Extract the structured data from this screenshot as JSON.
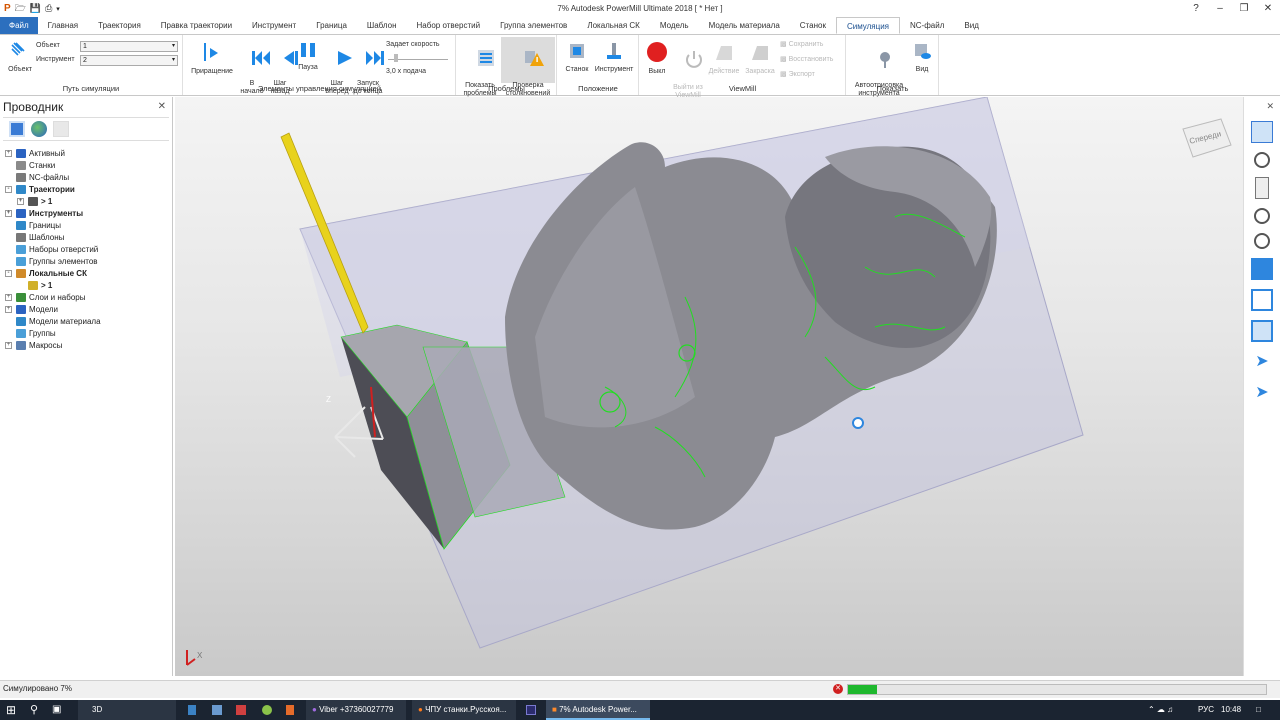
{
  "window": {
    "title": "7% Autodesk PowerMill Ultimate 2018   [ * Нет ]"
  },
  "tabs": [
    "Файл",
    "Главная",
    "Траектория",
    "Правка траектории",
    "Инструмент",
    "Граница",
    "Шаблон",
    "Набор отверстий",
    "Группа элементов",
    "Локальная СК",
    "Модель",
    "Модель материала",
    "Станок",
    "Симуляция",
    "NC-файл",
    "Вид"
  ],
  "active_tab": "Симуляция",
  "ribbon": {
    "sim_path": {
      "object_btn": "Объект",
      "object_label": "Объект",
      "object_value": "1",
      "tool_label": "Инструмент",
      "tool_value": "2",
      "group": "Путь симуляции"
    },
    "controls": {
      "step": "Приращение",
      "to_start": "В\nначало",
      "step_back": "Шаг\nназад",
      "pause": "Пауза",
      "step_fwd": "Шаг\nвперёд",
      "run_end": "Запуск\nдо конца",
      "speed_label": "Задает скорость",
      "speed_value": "3,0 x подача",
      "group": "Элементы управления симуляцией"
    },
    "problems": {
      "show": "Показать\nпроблемы",
      "collision": "Проверка\nстолкновений",
      "group": "Проблемы"
    },
    "position": {
      "machine": "Станок",
      "tool": "Инструмент",
      "group": "Положение"
    },
    "viewmill": {
      "off": "Выкл",
      "exit": "Выйти из\nViewMill",
      "action": "Действие",
      "shading": "Закраска",
      "save": "Сохранить",
      "restore": "Восстановить",
      "export": "Экспорт",
      "group": "ViewMill"
    },
    "show": {
      "autodraw": "Автоотрисовка\nинструмента",
      "view": "Вид",
      "group": "Показать"
    }
  },
  "explorer": {
    "title": "Проводник",
    "items": [
      {
        "label": "Активный",
        "bold": false,
        "level": 0,
        "exp": "+",
        "icon": "#2b63c1"
      },
      {
        "label": "Станки",
        "bold": false,
        "level": 0,
        "exp": "",
        "icon": "#8a8a8a"
      },
      {
        "label": "NC-файлы",
        "bold": false,
        "level": 0,
        "exp": "",
        "icon": "#7a7a7a"
      },
      {
        "label": "Траектории",
        "bold": true,
        "level": 0,
        "exp": "-",
        "icon": "#2f88c8"
      },
      {
        "label": "> 1",
        "bold": true,
        "level": 1,
        "exp": "+",
        "icon": "#555555"
      },
      {
        "label": "Инструменты",
        "bold": true,
        "level": 0,
        "exp": "+",
        "icon": "#2b63c1"
      },
      {
        "label": "Границы",
        "bold": false,
        "level": 0,
        "exp": "",
        "icon": "#2f88c8"
      },
      {
        "label": "Шаблоны",
        "bold": false,
        "level": 0,
        "exp": "",
        "icon": "#777777"
      },
      {
        "label": "Наборы отверстий",
        "bold": false,
        "level": 0,
        "exp": "",
        "icon": "#4a9fd8"
      },
      {
        "label": "Группы элементов",
        "bold": false,
        "level": 0,
        "exp": "",
        "icon": "#4a9fd8"
      },
      {
        "label": "Локальные СК",
        "bold": true,
        "level": 0,
        "exp": "-",
        "icon": "#d08a2a"
      },
      {
        "label": "> 1",
        "bold": true,
        "level": 1,
        "exp": "",
        "icon": "#d0b02a"
      },
      {
        "label": "Слои и наборы",
        "bold": false,
        "level": 0,
        "exp": "+",
        "icon": "#3a8f3a"
      },
      {
        "label": "Модели",
        "bold": false,
        "level": 0,
        "exp": "+",
        "icon": "#2b63c1"
      },
      {
        "label": "Модели материала",
        "bold": false,
        "level": 0,
        "exp": "",
        "icon": "#2f88c8"
      },
      {
        "label": "Группы",
        "bold": false,
        "level": 0,
        "exp": "",
        "icon": "#4a9fd8"
      },
      {
        "label": "Макросы",
        "bold": false,
        "level": 0,
        "exp": "+",
        "icon": "#5a7fb0"
      }
    ]
  },
  "viewport": {
    "cube_label": "Спереди",
    "axis_z": "Z",
    "axis_x": "X"
  },
  "status": {
    "text": "Симулировано 7%",
    "progress": 0.07
  },
  "taskbar": {
    "items": [
      "3D",
      "Viber +37360027779",
      "ЧПУ станки.Русскоя...",
      "7% Autodesk Power..."
    ],
    "lang": "РУС",
    "time": "10:48"
  },
  "colors": {
    "accent": "#2c6fbe",
    "ribbon_icon": "#1e88e5",
    "toolpath": "#22dd22",
    "tool": "#e8d21c",
    "stock": "#b9b9d6",
    "progress": "#1fb82e"
  }
}
